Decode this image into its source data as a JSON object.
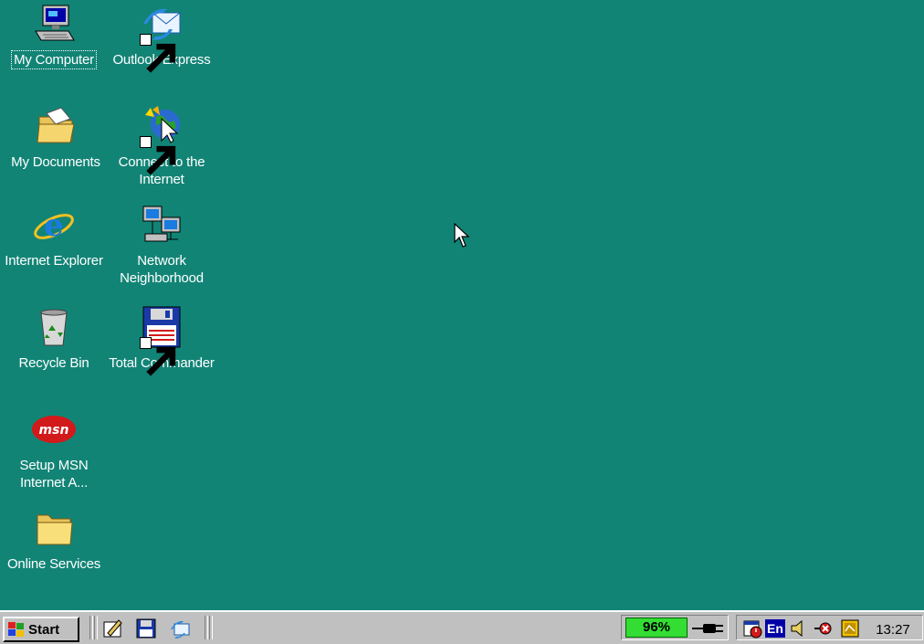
{
  "desktop": {
    "background_color": "#128476",
    "icons": [
      {
        "label": "My Computer",
        "icon": "computer-icon"
      },
      {
        "label": "Outlook Express",
        "icon": "outlook-express-icon"
      },
      {
        "label": "My Documents",
        "icon": "folder-documents-icon"
      },
      {
        "label": "Connect to the Internet",
        "icon": "connect-internet-icon"
      },
      {
        "label": "Internet Explorer",
        "icon": "internet-explorer-icon"
      },
      {
        "label": "Network Neighborhood",
        "icon": "network-icon"
      },
      {
        "label": "Recycle Bin",
        "icon": "recycle-bin-icon"
      },
      {
        "label": "Total Commander",
        "icon": "floppy-disk-icon"
      },
      {
        "label": "Setup MSN Internet A...",
        "icon": "msn-icon",
        "badge": "msn"
      },
      {
        "label": "Online Services",
        "icon": "folder-icon"
      }
    ]
  },
  "taskbar": {
    "start_label": "Start",
    "quick_launch": [
      "desktop-show-icon",
      "save-icon",
      "outlook-express-icon"
    ],
    "battery_level": "96%",
    "language": "En",
    "clock": "13:27",
    "tray_icons": [
      "power-plug-icon",
      "scheduler-icon",
      "language-icon",
      "volume-icon",
      "network-disconnected-icon",
      "app-tray-icon"
    ]
  }
}
